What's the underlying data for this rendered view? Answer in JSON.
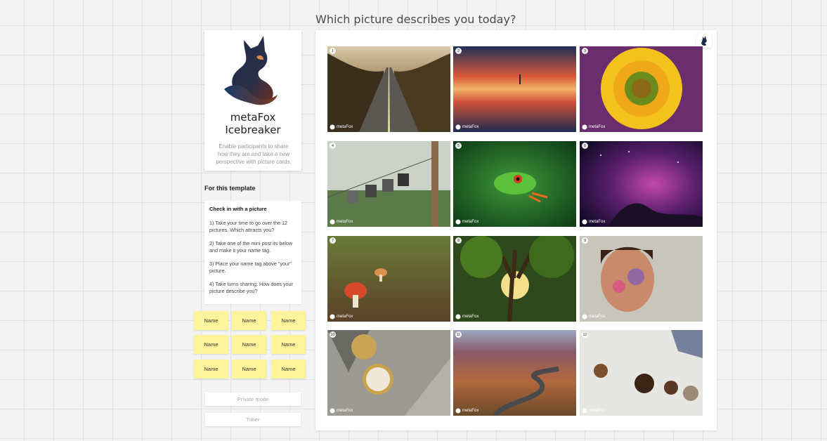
{
  "canvas": {
    "question": "Which picture describes you today?"
  },
  "logo_card": {
    "title_line1": "metaFox",
    "title_line2": "Icebreaker",
    "description": "Enable participants to share how they are and take a new perspective with picture cards."
  },
  "template_section": {
    "heading": "For this template"
  },
  "instructions": {
    "heading": "Check in with a picture",
    "steps": [
      "1) Take your time to go over the 12 pictures. Which attracts you?",
      "2) Take one of the mini post its below and make it your name tag.",
      "3) Place your name tag above \"your\" picture.",
      "4) Take turns sharing: How does your picture describe you?"
    ]
  },
  "name_tags": [
    "Name",
    "Name",
    "Name",
    "Name",
    "Name",
    "Name",
    "Name",
    "Name",
    "Name"
  ],
  "buttons": {
    "private_mode": "Private mode",
    "timer": "Timer"
  },
  "pictures": [
    {
      "number": "1",
      "subject": "road-through-forest"
    },
    {
      "number": "2",
      "subject": "sunset-reflection"
    },
    {
      "number": "3",
      "subject": "sunflower"
    },
    {
      "number": "4",
      "subject": "photos-on-clothesline"
    },
    {
      "number": "5",
      "subject": "tree-frog"
    },
    {
      "number": "6",
      "subject": "horsehead-nebula"
    },
    {
      "number": "7",
      "subject": "mushrooms"
    },
    {
      "number": "8",
      "subject": "giant-tree"
    },
    {
      "number": "9",
      "subject": "child-with-face-paint"
    },
    {
      "number": "10",
      "subject": "compass-on-rock"
    },
    {
      "number": "11",
      "subject": "desert-road"
    },
    {
      "number": "12",
      "subject": "tea-table"
    }
  ],
  "watermark": "metaFox",
  "colors": {
    "sticky": "#fdf49c",
    "fox_dark": "#1b2a44",
    "fox_accent": "#5a2b1e"
  }
}
